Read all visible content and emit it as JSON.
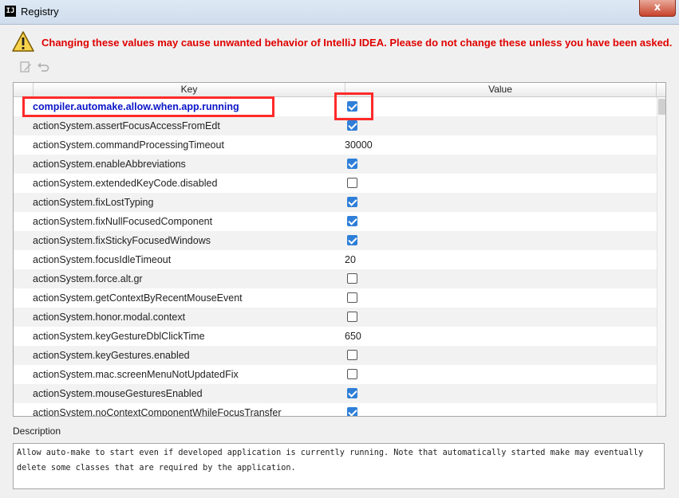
{
  "window": {
    "title": "Registry",
    "app_icon": "IJ",
    "close_glyph": "x"
  },
  "warning": {
    "icon": "warning-triangle-icon",
    "text": "Changing these values may cause unwanted behavior of IntelliJ IDEA. Please do not change these unless you have been asked."
  },
  "toolbar": {
    "edit_icon": "edit-icon",
    "revert_icon": "revert-icon"
  },
  "table": {
    "columns": {
      "key": "Key",
      "value": "Value"
    },
    "rows": [
      {
        "key": "compiler.automake.allow.when.app.running",
        "type": "bool",
        "checked": true,
        "selected": true
      },
      {
        "key": "actionSystem.assertFocusAccessFromEdt",
        "type": "bool",
        "checked": true
      },
      {
        "key": "actionSystem.commandProcessingTimeout",
        "type": "text",
        "value": "30000"
      },
      {
        "key": "actionSystem.enableAbbreviations",
        "type": "bool",
        "checked": true
      },
      {
        "key": "actionSystem.extendedKeyCode.disabled",
        "type": "bool",
        "checked": false
      },
      {
        "key": "actionSystem.fixLostTyping",
        "type": "bool",
        "checked": true
      },
      {
        "key": "actionSystem.fixNullFocusedComponent",
        "type": "bool",
        "checked": true
      },
      {
        "key": "actionSystem.fixStickyFocusedWindows",
        "type": "bool",
        "checked": true
      },
      {
        "key": "actionSystem.focusIdleTimeout",
        "type": "text",
        "value": "20"
      },
      {
        "key": "actionSystem.force.alt.gr",
        "type": "bool",
        "checked": false
      },
      {
        "key": "actionSystem.getContextByRecentMouseEvent",
        "type": "bool",
        "checked": false
      },
      {
        "key": "actionSystem.honor.modal.context",
        "type": "bool",
        "checked": false
      },
      {
        "key": "actionSystem.keyGestureDblClickTime",
        "type": "text",
        "value": "650"
      },
      {
        "key": "actionSystem.keyGestures.enabled",
        "type": "bool",
        "checked": false
      },
      {
        "key": "actionSystem.mac.screenMenuNotUpdatedFix",
        "type": "bool",
        "checked": false
      },
      {
        "key": "actionSystem.mouseGesturesEnabled",
        "type": "bool",
        "checked": true
      },
      {
        "key": "actionSystem.noContextComponentWhileFocusTransfer",
        "type": "bool",
        "checked": true
      }
    ]
  },
  "description": {
    "label": "Description",
    "text": "Allow auto-make to start even if developed application is currently running. Note that automatically started make may eventually delete some classes that are required by the application."
  },
  "colors": {
    "warning_text": "#e00000",
    "selected_key": "#0a14c8",
    "checkbox_checked": "#2f7fd8",
    "highlight_box": "#ff2a2a"
  }
}
